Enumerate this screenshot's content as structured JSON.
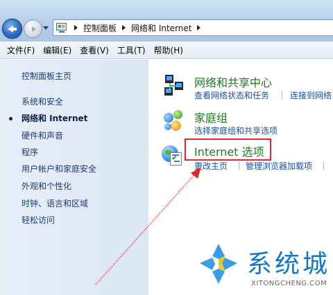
{
  "address_bar": {
    "crumbs": [
      "控制面板",
      "网络和 Internet"
    ]
  },
  "menu": {
    "items": [
      "文件(F)",
      "编辑(E)",
      "查看(V)",
      "工具(T)",
      "帮助(H)"
    ]
  },
  "sidebar": {
    "items": [
      {
        "label": "控制面板主页",
        "active": false
      },
      {
        "label": "系统和安全",
        "active": false
      },
      {
        "label": "网络和 Internet",
        "active": true
      },
      {
        "label": "硬件和声音",
        "active": false
      },
      {
        "label": "程序",
        "active": false
      },
      {
        "label": "用户帐户和家庭安全",
        "active": false
      },
      {
        "label": "外观和个性化",
        "active": false
      },
      {
        "label": "时钟、语言和区域",
        "active": false
      },
      {
        "label": "轻松访问",
        "active": false
      }
    ]
  },
  "main": {
    "categories": [
      {
        "title": "网络和共享中心",
        "icon": "network-icon",
        "links": [
          "查看网络状态和任务",
          "连接到网络"
        ]
      },
      {
        "title": "家庭组",
        "icon": "homegroup-icon",
        "links": [
          "选择家庭组和共享选项"
        ]
      },
      {
        "title": "Internet 选项",
        "icon": "internet-options-icon",
        "links": [
          "更改主页",
          "管理浏览器加载项"
        ]
      }
    ]
  },
  "annotation": {
    "highlight_color": "#e2262f",
    "arrow_color": "#e2262f"
  },
  "watermark": {
    "text": "系统城",
    "subtext": "XITONGCHENG.COM",
    "color": "#1178c8"
  }
}
